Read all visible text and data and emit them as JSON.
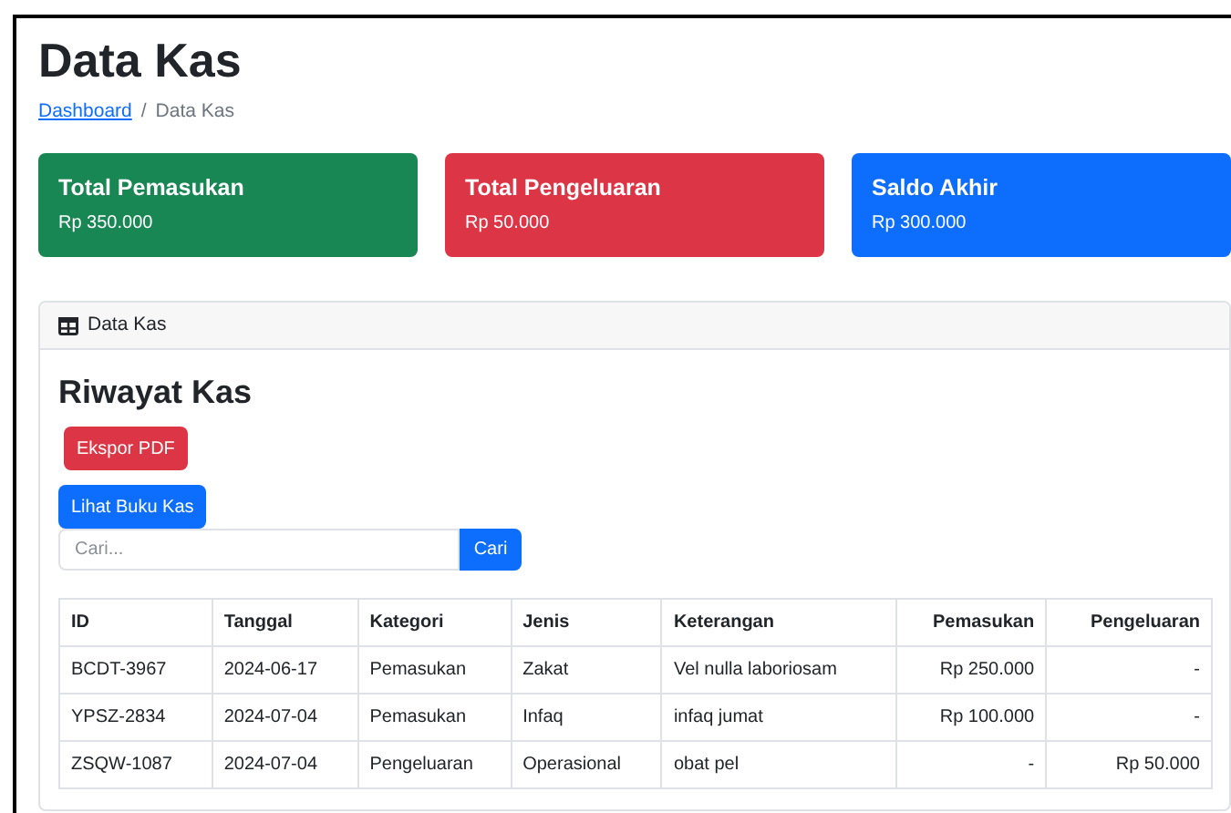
{
  "page_title": "Data Kas",
  "breadcrumb_separator": "/",
  "breadcrumb": [
    {
      "label": "Dashboard",
      "kind": "link"
    },
    {
      "label": "Data Kas",
      "kind": "current"
    }
  ],
  "summary_cards": [
    {
      "title": "Total Pemasukan",
      "value": "Rp 350.000",
      "color": "#198754"
    },
    {
      "title": "Total Pengeluaran",
      "value": "Rp 50.000",
      "color": "#dc3545"
    },
    {
      "title": "Saldo Akhir",
      "value": "Rp 300.000",
      "color": "#0d6efd"
    }
  ],
  "panel": {
    "header": "Data Kas",
    "title": "Riwayat Kas",
    "export_button": "Ekspor PDF",
    "ledger_button": "Lihat Buku Kas",
    "search": {
      "placeholder": "Cari...",
      "button": "Cari"
    },
    "table": {
      "columns": [
        {
          "label": "ID",
          "kind": "text"
        },
        {
          "label": "Tanggal",
          "kind": "text"
        },
        {
          "label": "Kategori",
          "kind": "text"
        },
        {
          "label": "Jenis",
          "kind": "text"
        },
        {
          "label": "Keterangan",
          "kind": "text"
        },
        {
          "label": "Pemasukan",
          "kind": "amount"
        },
        {
          "label": "Pengeluaran",
          "kind": "amount"
        }
      ],
      "rows": [
        [
          "BCDT-3967",
          "2024-06-17",
          "Pemasukan",
          "Zakat",
          "Vel nulla laboriosam",
          "Rp 250.000",
          "-"
        ],
        [
          "YPSZ-2834",
          "2024-07-04",
          "Pemasukan",
          "Infaq",
          "infaq jumat",
          "Rp 100.000",
          "-"
        ],
        [
          "ZSQW-1087",
          "2024-07-04",
          "Pengeluaran",
          "Operasional",
          "obat pel",
          "-",
          "Rp 50.000"
        ]
      ]
    }
  }
}
